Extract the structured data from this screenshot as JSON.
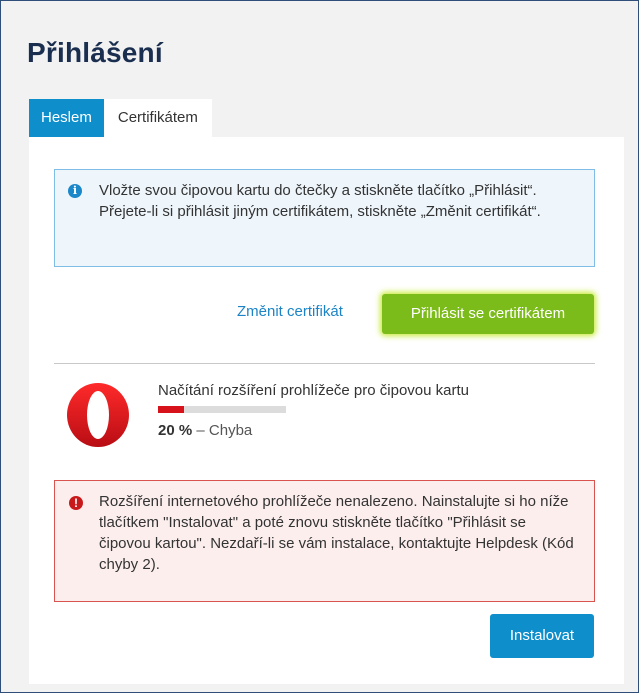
{
  "page": {
    "title": "Přihlášení"
  },
  "tabs": [
    {
      "label": "Heslem",
      "active": true
    },
    {
      "label": "Certifikátem",
      "active": false
    }
  ],
  "info": {
    "icon": "info-icon",
    "text": "Vložte svou čipovou kartu do čtečky a stiskněte tlačítko „Přihlásit“. Přejete-li si přihlásit jiným certifikátem, stiskněte „Změnit certifikát“."
  },
  "actions": {
    "change_cert_label": "Změnit certifikát",
    "login_cert_label": "Přihlásit se certifikátem"
  },
  "progress": {
    "browser_icon": "opera-logo-icon",
    "title": "Načítání rozšíření prohlížeče pro čipovou kartu",
    "percent": 20,
    "percent_text": "20 %",
    "separator": "–",
    "status": "Chyba"
  },
  "error": {
    "icon": "error-icon",
    "text": "Rozšíření internetového prohlížeče nenalezeno. Nainstalujte si ho níže tlačítkem \"Instalovat\" a poté znovu stiskněte tlačítko \"Přihlásit se čipovou kartou\". Nezdaří-li se vám instalace, kontaktujte Helpdesk (Kód chyby 2)."
  },
  "install": {
    "label": "Instalovat"
  },
  "colors": {
    "accent": "#0e8fcc",
    "success": "#7bbb1a",
    "danger": "#d8121b",
    "title": "#1a2e4f"
  }
}
